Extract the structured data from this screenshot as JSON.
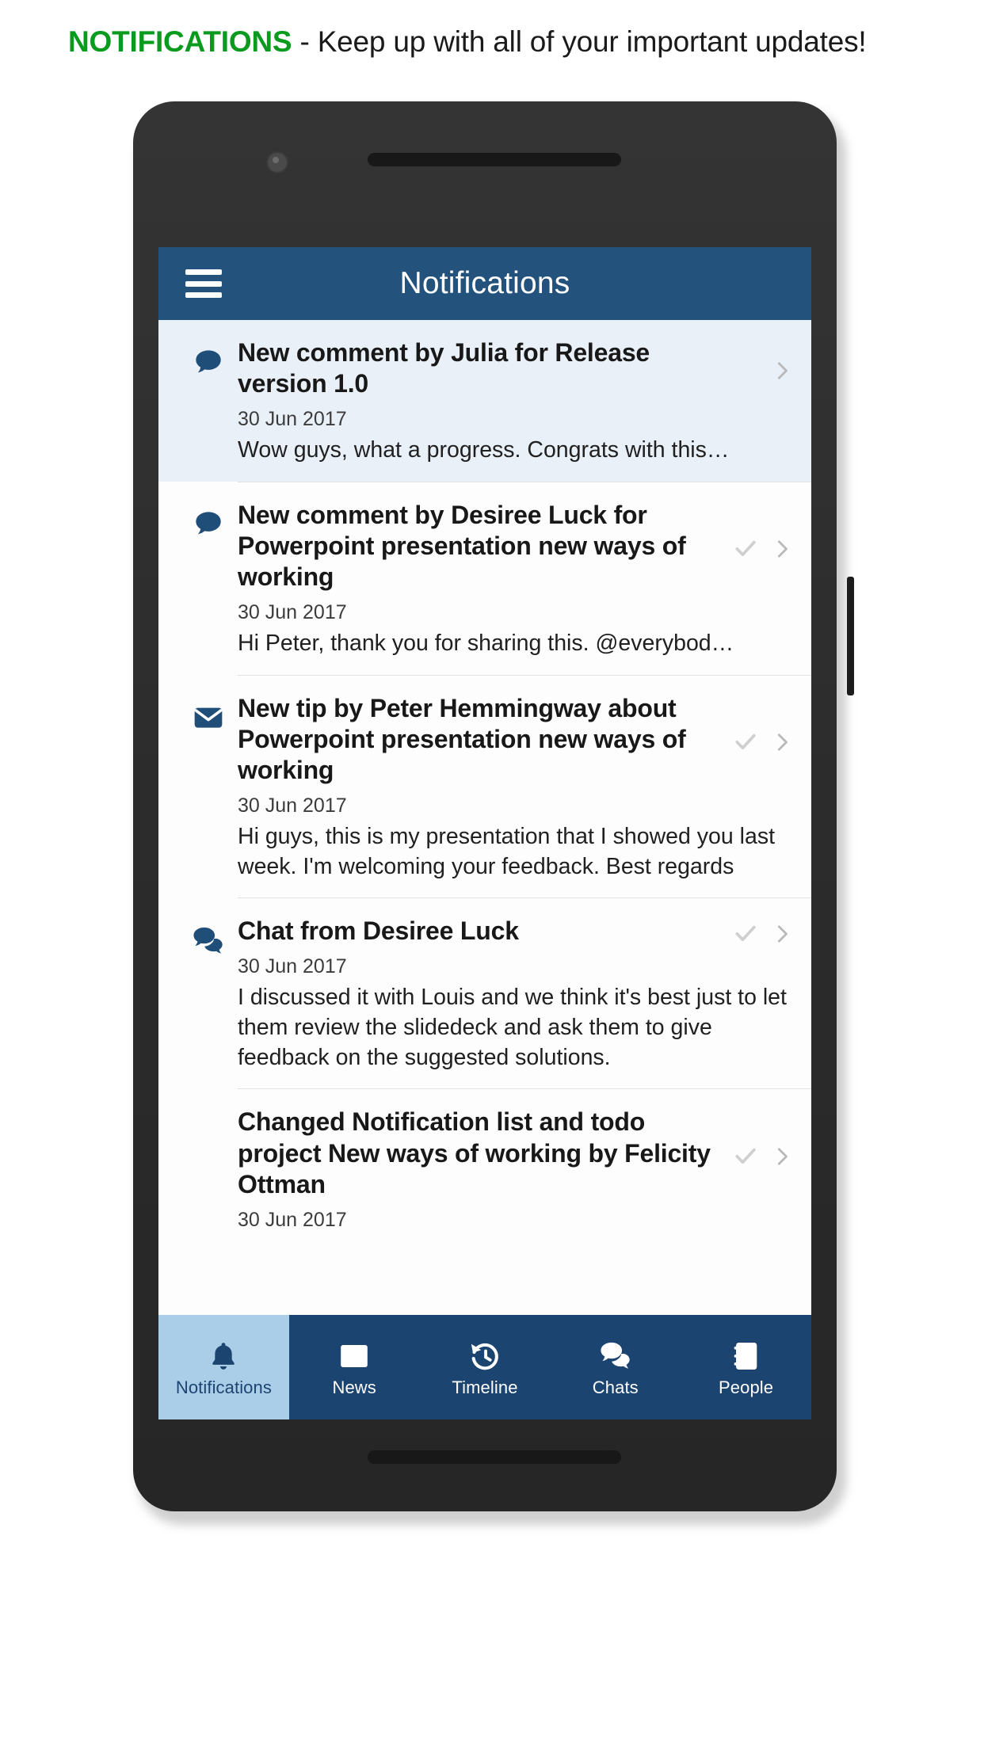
{
  "banner": {
    "keyword": "NOTIFICATIONS",
    "rest": " - Keep up with all of your important updates!",
    "keyword_color": "#0a9a1e"
  },
  "app": {
    "title": "Notifications",
    "menu_icon": "hamburger-menu-icon",
    "appbar_color": "#23527c",
    "accent_color": "#1c4470"
  },
  "notifications": [
    {
      "icon": "comment-bubble-icon",
      "title": "New comment by Julia for Release version 1.0",
      "date": "30 Jun 2017",
      "text": "Wow guys, what a progress. Congrats with this…",
      "unread": true,
      "has_check": false,
      "has_chevron": true
    },
    {
      "icon": "comment-bubble-icon",
      "title": "New comment by Desiree Luck for Powerpoint presentation new ways of working",
      "date": "30 Jun 2017",
      "text": "Hi Peter, thank you for sharing this. @everybod…",
      "unread": false,
      "has_check": true,
      "has_chevron": true
    },
    {
      "icon": "envelope-icon",
      "title": "New tip by Peter Hemmingway about Powerpoint presentation new ways of working",
      "date": "30 Jun 2017",
      "text": "Hi guys, this is my presentation that I showed you last week. I'm welcoming your feedback. Best regards",
      "unread": false,
      "has_check": true,
      "has_chevron": true
    },
    {
      "icon": "chats-double-bubble-icon",
      "title": "Chat from Desiree Luck",
      "date": "30 Jun 2017",
      "text": "I discussed it with Louis and we think it's best just to let them review the slidedeck and ask them to give feedback on the suggested solutions.",
      "unread": false,
      "has_check": true,
      "has_chevron": true
    },
    {
      "icon": "none",
      "title": "Changed Notification list and todo project New ways of working by Felicity Ottman",
      "date": "30 Jun 2017",
      "text": "",
      "unread": false,
      "has_check": true,
      "has_chevron": true
    }
  ],
  "bottom_nav": [
    {
      "label": "Notifications",
      "icon": "bell-icon",
      "active": true
    },
    {
      "label": "News",
      "icon": "newspaper-icon",
      "active": false
    },
    {
      "label": "Timeline",
      "icon": "history-clock-icon",
      "active": false
    },
    {
      "label": "Chats",
      "icon": "chats-double-bubble-icon",
      "active": false
    },
    {
      "label": "People",
      "icon": "contact-card-icon",
      "active": false
    }
  ]
}
